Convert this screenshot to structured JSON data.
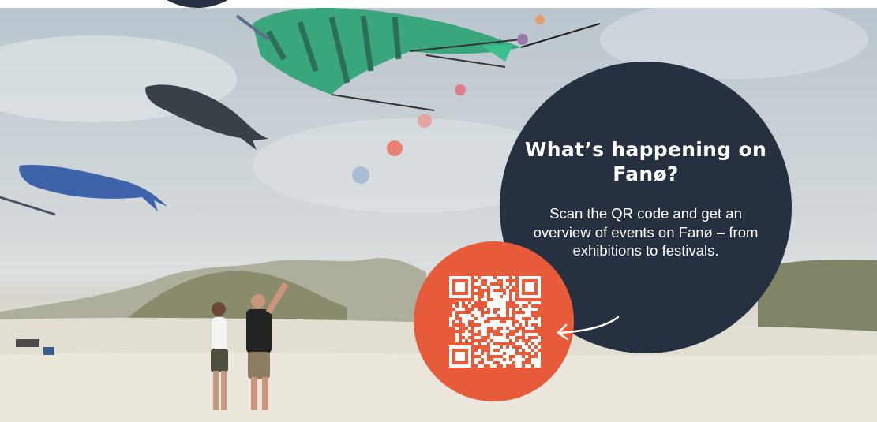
{
  "promo": {
    "title": "What’s happening on Fanø?",
    "body": "Scan the QR code and get an overview of events on Fanø – from exhibitions to festivals."
  },
  "colors": {
    "navy": "#263040",
    "orange": "#e75b3a",
    "white": "#ffffff"
  },
  "icons": {
    "qr": "qr-code-icon",
    "arrow": "curved-arrow-icon"
  }
}
